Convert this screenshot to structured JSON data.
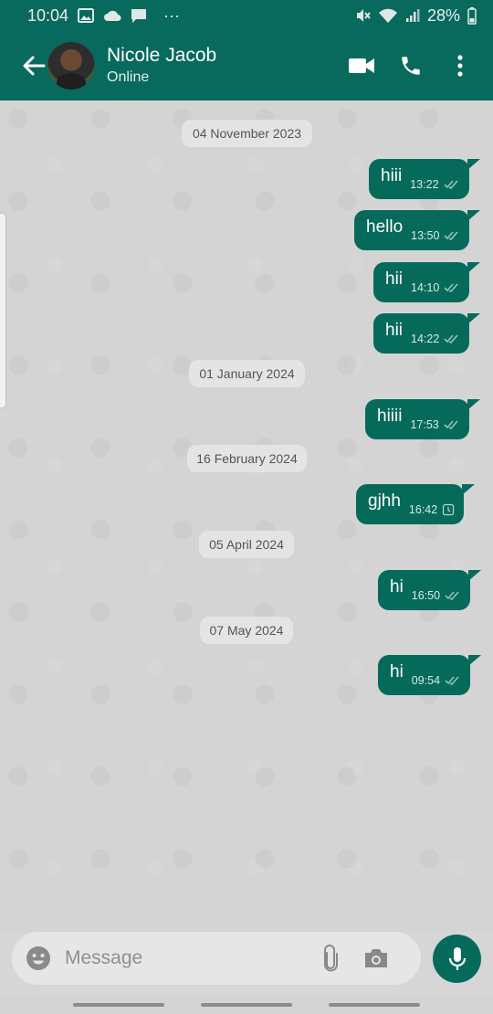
{
  "status_bar": {
    "time": "10:04",
    "battery": "28%",
    "more": "···"
  },
  "header": {
    "contact_name": "Nicole Jacob",
    "contact_status": "Online"
  },
  "dates": [
    "04 November 2023",
    "01 January 2024",
    "16 February 2024",
    "05 April 2024",
    "07 May 2024"
  ],
  "messages": [
    {
      "text": "hiii",
      "time": "13:22",
      "status": "read"
    },
    {
      "text": "hello",
      "time": "13:50",
      "status": "read"
    },
    {
      "text": "hii",
      "time": "14:10",
      "status": "read"
    },
    {
      "text": "hii",
      "time": "14:22",
      "status": "read"
    },
    {
      "text": "hiiii",
      "time": "17:53",
      "status": "read"
    },
    {
      "text": "gjhh",
      "time": "16:42",
      "status": "pending"
    },
    {
      "text": "hi",
      "time": "16:50",
      "status": "read"
    },
    {
      "text": "hi",
      "time": "09:54",
      "status": "read"
    }
  ],
  "composer": {
    "placeholder": "Message"
  },
  "colors": {
    "primary": "#076a5d",
    "bubble": "#066a5b",
    "chat_background": "#d4d4d4",
    "date_pill": "#e4e4e4"
  }
}
